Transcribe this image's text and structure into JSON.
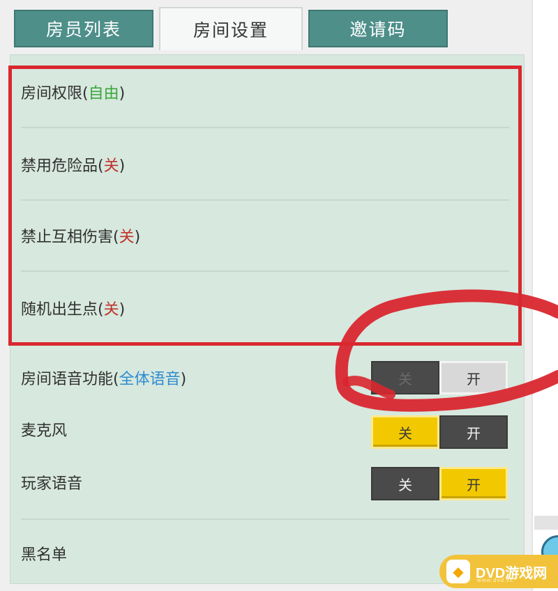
{
  "tabs": [
    {
      "label": "房员列表",
      "active": false
    },
    {
      "label": "房间设置",
      "active": true
    },
    {
      "label": "邀请码",
      "active": false
    }
  ],
  "settings": {
    "room_permission": {
      "label": "房间权限",
      "value": "自由",
      "value_color": "#3aa63a"
    },
    "disable_dangerous": {
      "label": "禁用危险品",
      "value": "关",
      "value_color": "#c0322d"
    },
    "no_mutual_damage": {
      "label": "禁止互相伤害",
      "value": "关",
      "value_color": "#c0322d"
    },
    "random_spawn": {
      "label": "随机出生点",
      "value": "关",
      "value_color": "#c0322d"
    }
  },
  "voice": {
    "room_voice": {
      "label": "房间语音功能",
      "value": "全体语音",
      "off_label": "关",
      "on_label": "开",
      "state": "on"
    },
    "microphone": {
      "label": "麦克风",
      "off_label": "关",
      "on_label": "开",
      "state": "off"
    },
    "player_voice": {
      "label": "玩家语音",
      "off_label": "关",
      "on_label": "开",
      "state": "on"
    }
  },
  "blacklist": {
    "label": "黑名单"
  },
  "watermark": {
    "text": "DVD游戏网",
    "sub": "www.dvd.cc"
  },
  "colors": {
    "tab_inactive": "#4e8f8a",
    "panel_bg": "#d7e8de",
    "highlight_red": "#d9272f",
    "toggle_yellow": "#f2c900",
    "toggle_dark": "#4a4a4a"
  },
  "icons": {
    "watermark_logo": "gamepad-icon",
    "corner_avatar": "avatar-icon"
  }
}
